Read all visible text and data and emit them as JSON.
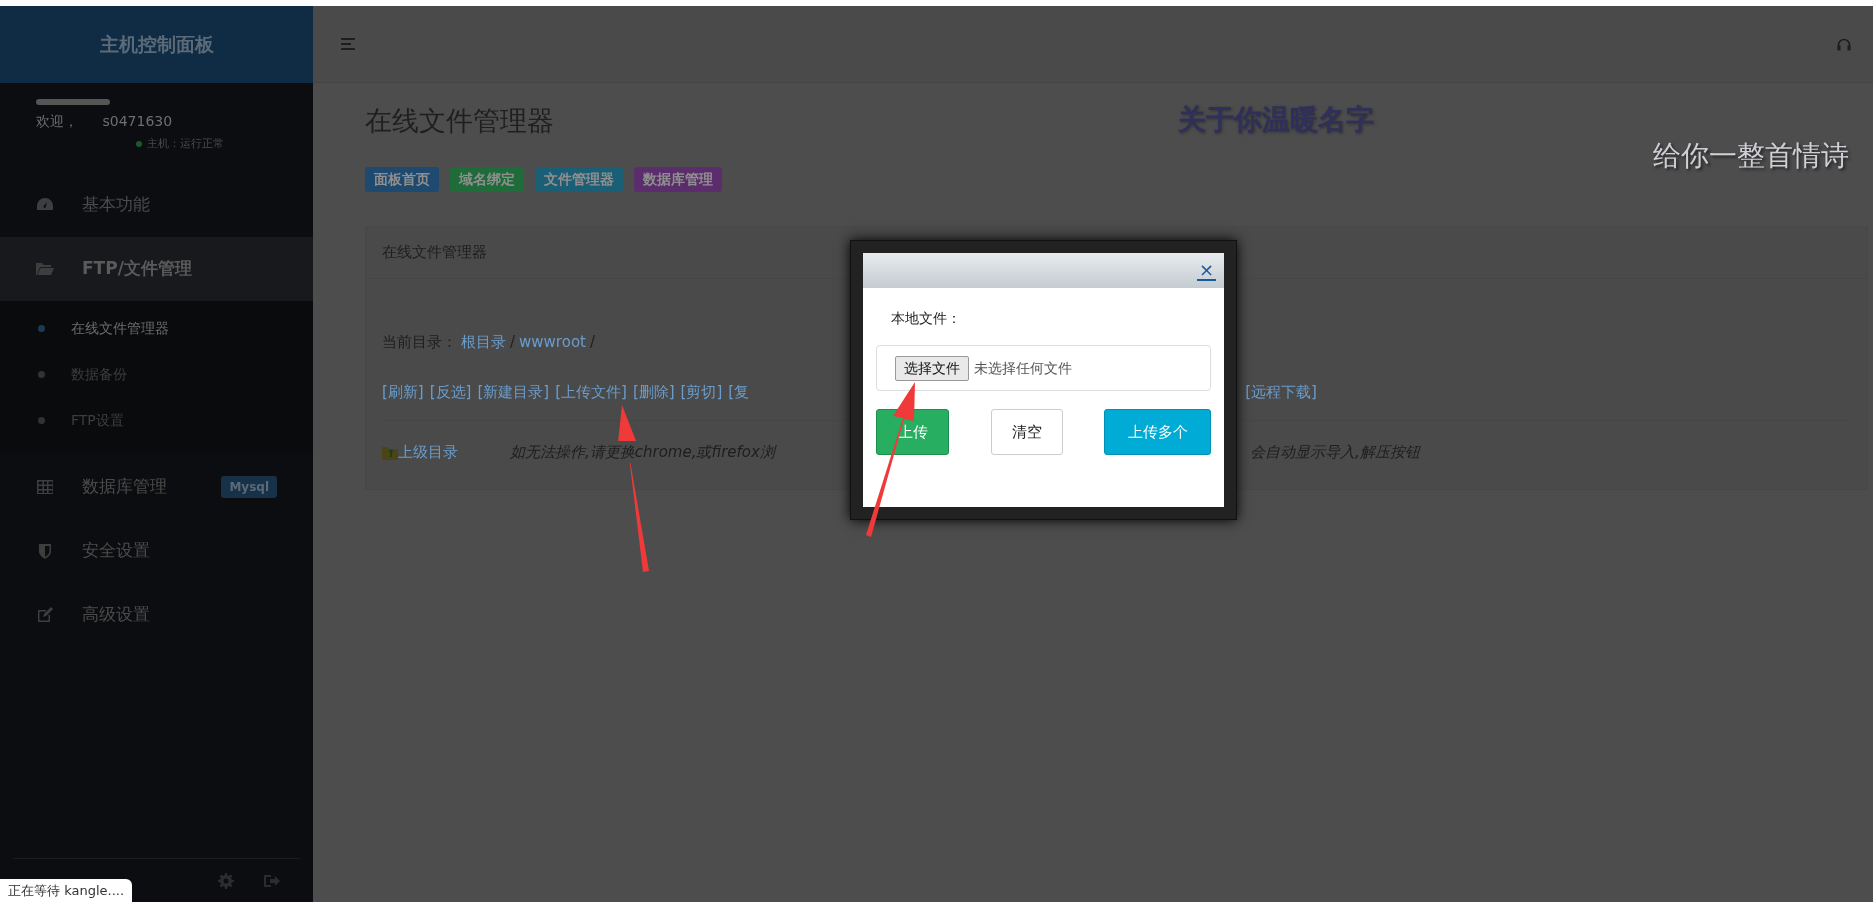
{
  "sidebar": {
    "brand": "主机控制面板",
    "welcome": "欢迎，",
    "username": "s0471630",
    "host_status": "主机：运行正常",
    "menu": [
      {
        "label": "基本功能",
        "selected": false
      },
      {
        "label": "FTP/文件管理",
        "selected": true,
        "children": [
          {
            "label": "在线文件管理器",
            "selected": true
          },
          {
            "label": "数据备份",
            "selected": false
          },
          {
            "label": "FTP设置",
            "selected": false
          }
        ]
      },
      {
        "label": "数据库管理",
        "selected": false,
        "badge": "Mysql"
      },
      {
        "label": "安全设置",
        "selected": false
      },
      {
        "label": "高级设置",
        "selected": false
      }
    ]
  },
  "page": {
    "title": "在线文件管理器",
    "floating_texts": [
      {
        "text": "关于你温暖名字",
        "kind": "dark"
      },
      {
        "text": "给你一整首情诗",
        "kind": "light"
      }
    ],
    "quick_links": [
      {
        "label": "面板首页",
        "color": "#1e4a70"
      },
      {
        "label": "域名绑定",
        "color": "#1f6b3a"
      },
      {
        "label": "文件管理器",
        "color": "#1a5f75"
      },
      {
        "label": "数据库管理",
        "color": "#5b2d6c"
      }
    ],
    "panel": {
      "title": "在线文件管理器",
      "current_dir_label": "当前目录：",
      "breadcrumb": [
        {
          "kind": "link",
          "text": "根目录"
        },
        {
          "kind": "sep",
          "text": "/"
        },
        {
          "kind": "link",
          "text": "wwwroot"
        },
        {
          "kind": "sep",
          "text": "/"
        }
      ],
      "actions_left": [
        "[刷新]",
        "[反选]",
        "[新建目录]",
        "[上传文件]",
        "[删除]",
        "[剪切]",
        "[复"
      ],
      "actions_right": [
        "[远程下载]"
      ],
      "parent_dir": "上级目录",
      "hint_left": "如无法操作,请更换chrome,或firefox浏",
      "hint_right": "会自动显示导入,解压按钮"
    }
  },
  "modal": {
    "close": "×",
    "label": "本地文件：",
    "file_button": "选择文件",
    "file_status": "未选择任何文件",
    "buttons": [
      {
        "label": "上传",
        "kind": "success"
      },
      {
        "label": "清空",
        "kind": "default"
      },
      {
        "label": "上传多个",
        "kind": "info"
      }
    ]
  },
  "status_bubble": "正在等待 kangle...."
}
